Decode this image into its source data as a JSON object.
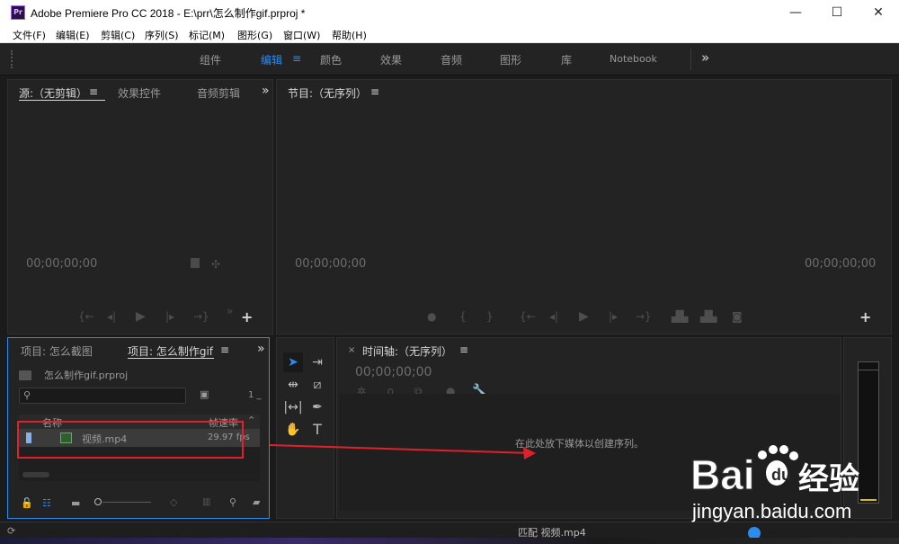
{
  "window": {
    "app_icon": "Pr",
    "title": "Adobe Premiere Pro CC 2018 - E:\\prr\\怎么制作gif.prproj *",
    "minimize": "—",
    "maximize": "☐",
    "close": "✕"
  },
  "menu": [
    "文件(F)",
    "编辑(E)",
    "剪辑(C)",
    "序列(S)",
    "标记(M)",
    "图形(G)",
    "窗口(W)",
    "帮助(H)"
  ],
  "workspaces": {
    "tabs": [
      "组件",
      "编辑",
      "颜色",
      "效果",
      "音频",
      "图形",
      "库",
      "Notebook"
    ],
    "active": "编辑",
    "overflow": "»",
    "menu_icon": "≡"
  },
  "source_panel": {
    "tabs": [
      "源:（无剪辑）",
      "效果控件",
      "音频剪辑"
    ],
    "active_tab": "源:（无剪辑）",
    "menu_icon": "≡",
    "overflow": "»",
    "timecode": "00;00;00;00",
    "add": "+"
  },
  "program_panel": {
    "title": "节目:（无序列）",
    "menu_icon": "≡",
    "timecode_left": "00;00;00;00",
    "timecode_right": "00;00;00;00",
    "add": "+"
  },
  "project_panel": {
    "tabs": [
      "项目: 怎么截图",
      "项目: 怎么制作gif"
    ],
    "active_tab": "项目: 怎么制作gif",
    "menu_icon": "≡",
    "overflow": "»",
    "file_name": "怎么制作gif.prproj",
    "search_placeholder": "",
    "item_count": "1 _",
    "columns": {
      "name": "名称",
      "framerate": "帧速率"
    },
    "items": [
      {
        "name": "视频.mp4",
        "framerate": "29.97 fps"
      }
    ]
  },
  "timeline_panel": {
    "close": "×",
    "title": "时间轴:（无序列）",
    "menu_icon": "≡",
    "timecode": "00;00;00;00",
    "drop_hint": "在此处放下媒体以创建序列。"
  },
  "status": {
    "text": "匹配 视频.mp4"
  },
  "watermark": {
    "brand": "Bai du 经验",
    "url": "jingyan.baidu.com"
  },
  "colors": {
    "accent": "#2d8ceb",
    "annotation": "#e0212d",
    "panel_bg": "#232323",
    "app_bg": "#1b1b1b"
  },
  "icons": [
    "premiere-app-icon",
    "search-icon",
    "folder-icon",
    "lock-icon",
    "list-view-icon",
    "icon-view-icon",
    "selection-tool-icon",
    "track-select-icon",
    "ripple-edit-icon",
    "razor-icon",
    "slip-icon",
    "pen-icon",
    "hand-icon",
    "type-icon",
    "wrench-icon",
    "camera-icon",
    "play-icon"
  ]
}
